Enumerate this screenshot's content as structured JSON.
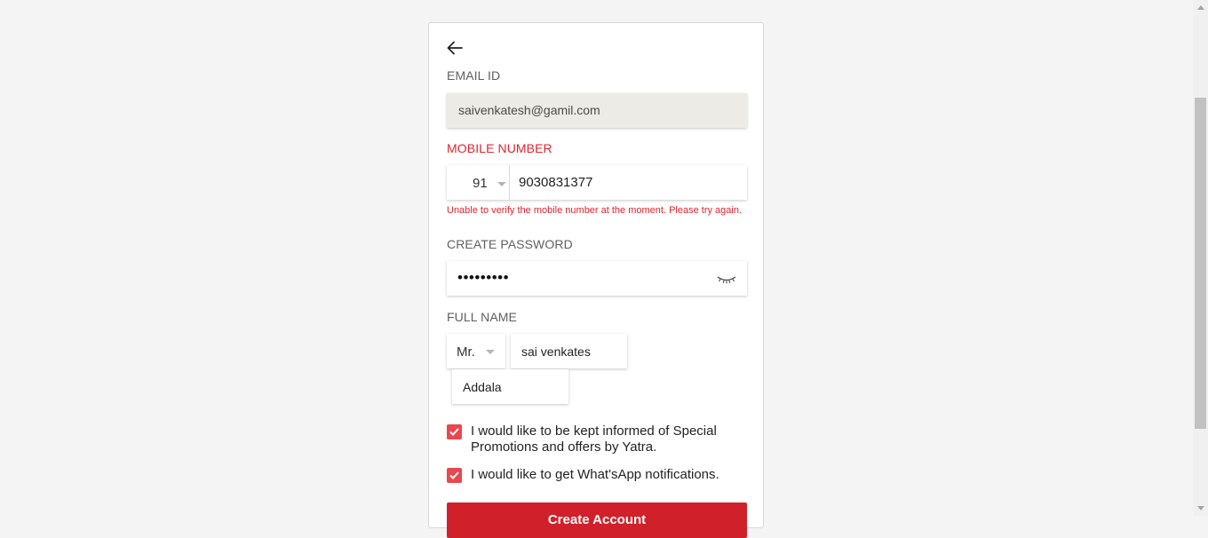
{
  "form": {
    "email_label": "EMAIL ID",
    "email_value": "saivenkatesh@gamil.com",
    "mobile_label": "MOBILE NUMBER",
    "country_code": "91",
    "mobile_value": "9030831377",
    "mobile_error": "Unable to verify the mobile number at the moment. Please try again.",
    "password_label": "CREATE PASSWORD",
    "password_masked": "•••••••••",
    "fullname_label": "FULL NAME",
    "title_value": "Mr.",
    "first_name": "sai venkates",
    "last_name": "Addala",
    "checkbox_promotions": "I would like to be kept informed of Special Promotions and offers by Yatra.",
    "checkbox_whatsapp": "I would like to get What'sApp notifications.",
    "submit_label": "Create Account"
  },
  "icons": {
    "back": "arrow-left-icon",
    "eye": "eye-closed-icon",
    "check": "check-icon"
  },
  "colors": {
    "accent_red": "#d0212b",
    "error_red": "#e0242f",
    "checkbox_red": "#e8484f",
    "email_bg": "#ecebe6"
  }
}
